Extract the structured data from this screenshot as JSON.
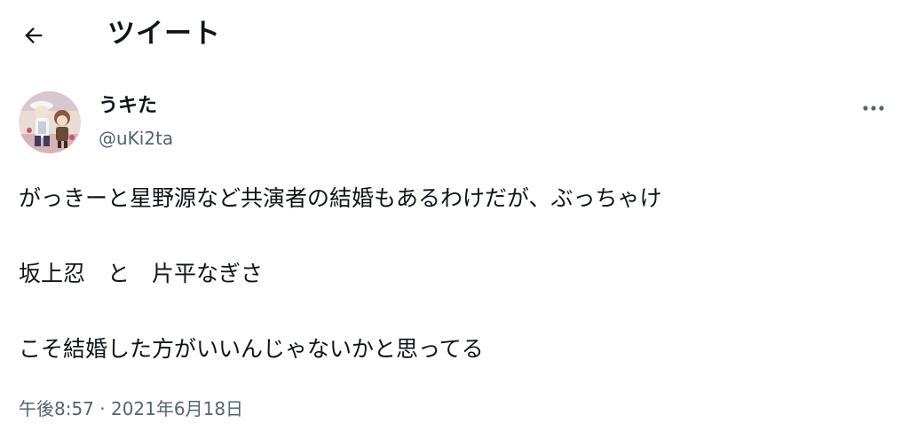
{
  "header": {
    "title": "ツイート",
    "back_icon": "arrow-left-icon"
  },
  "tweet": {
    "author": {
      "display_name": "うキた",
      "handle": "@uKi2ta"
    },
    "more_icon": "more-horizontal-icon",
    "text_lines": [
      "がっきーと星野源など共演者の結婚もあるわけだが、ぶっちゃけ",
      "坂上忍　と　片平なぎさ",
      "こそ結婚した方がいいんじゃないかと思ってる"
    ],
    "timestamp": "午後8:57 · 2021年6月18日"
  },
  "colors": {
    "text_primary": "#0f1419",
    "text_secondary": "#536471",
    "background": "#ffffff"
  }
}
